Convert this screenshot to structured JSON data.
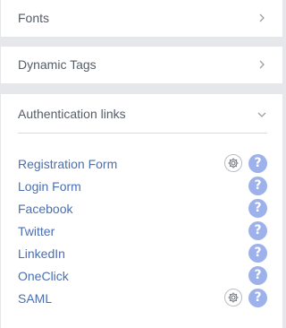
{
  "sections": [
    {
      "title": "Fonts",
      "state": "collapsed",
      "icon": "chevron-right-icon"
    },
    {
      "title": "Dynamic Tags",
      "state": "collapsed",
      "icon": "chevron-right-icon"
    },
    {
      "title": "Authentication links",
      "state": "expanded",
      "icon": "chevron-down-icon"
    }
  ],
  "auth_links": [
    {
      "label": "Registration Form",
      "has_settings": true
    },
    {
      "label": "Login Form",
      "has_settings": false
    },
    {
      "label": "Facebook",
      "has_settings": false
    },
    {
      "label": "Twitter",
      "has_settings": false
    },
    {
      "label": "LinkedIn",
      "has_settings": false
    },
    {
      "label": "OneClick",
      "has_settings": false
    },
    {
      "label": "SAML",
      "has_settings": true
    }
  ],
  "icons": {
    "help": "help-icon",
    "help_glyph": "?",
    "settings": "gear-icon"
  },
  "colors": {
    "background": "#e6e7ea",
    "panel": "#ffffff",
    "link": "#4a6fb3",
    "help_badge": "#9db1ea",
    "section_title": "#555d66"
  }
}
